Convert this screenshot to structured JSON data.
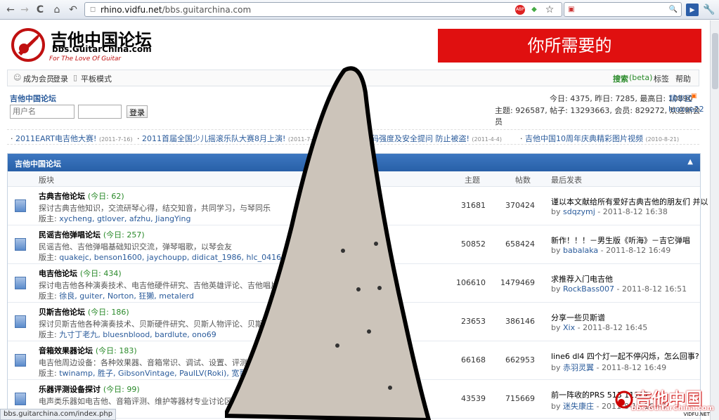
{
  "browser": {
    "url_host": "rhino.vidfu.net",
    "url_path": "/bbs.guitarchina.com",
    "back": "←",
    "forward": "→",
    "reload": "C",
    "home": "⌂",
    "undo": "↶",
    "abp": "ABP",
    "star": "☆",
    "search_icon": "🔍"
  },
  "site": {
    "logo_main": "吉他中国论坛",
    "logo_sub": "bbs.GuitarChina.com",
    "logo_tag": "For The Love Of Guitar",
    "ad_text": "你所需要的"
  },
  "topbar": {
    "register": "成为会员",
    "login": "登录",
    "tablet": "平板模式",
    "search": "搜索",
    "beta": "(beta)",
    "tags": "标签",
    "help": "帮助"
  },
  "userbox": {
    "title": "吉他中国论坛",
    "username_placeholder": "用户名",
    "login_btn": "登录"
  },
  "stats": {
    "line1": "今日: 4375, 昨日: 7285, 最高日: 10890",
    "highlight": "精华区",
    "line2": "主题: 926587, 帖子: 13293663, 会员: 829272, 欢迎新会员",
    "newest": "luoxue22"
  },
  "news": [
    {
      "title": "2011EART电吉他大赛!",
      "date": "(2011-7-16)"
    },
    {
      "title": "2011首届全国少儿摇滚乐队大赛8月上演!",
      "date": "(2011-7-5)"
    },
    {
      "title": "密码强度及安全提问 防止被盗!",
      "date": "(2011-4-4)"
    },
    {
      "title": "吉他中国10周年庆典精彩图片视频",
      "date": "(2010-8-21)"
    }
  ],
  "forum": {
    "title": "吉他中国论坛",
    "collapse": "▲",
    "col_board": "版块",
    "col_topics": "主题",
    "col_posts": "帖数",
    "col_last": "最后发表",
    "boards": [
      {
        "name": "古典吉他论坛",
        "today": "(今日: 62)",
        "desc": "探讨古典吉他知识，交流研琴心得，结交知音，共同学习，与琴同乐",
        "mods_label": "版主:",
        "mods": "xycheng, gtlover, afzhu, JiangYing",
        "topics": "31681",
        "posts": "370424",
        "last": "谨以本文献给所有爱好古典吉他的朋友们 并以 ...",
        "by_label": "by",
        "by": "sdqzymj",
        "time": "- 2011-8-12 16:38"
      },
      {
        "name": "民谣吉他弹唱论坛",
        "today": "(今日: 257)",
        "desc": "民谣吉他、吉他弹唱基础知识交流，弹琴唱歌，以琴会友",
        "mods_label": "版主:",
        "mods": "quakejc, benson1600, jaychoupp, didicat_1986, hlc_0416",
        "topics": "50852",
        "posts": "658424",
        "last": "新作！！！－男生版《听海》－吉它弹唱",
        "by_label": "by",
        "by": "babalaka",
        "time": "- 2011-8-12 16:49"
      },
      {
        "name": "电吉他论坛",
        "today": "(今日: 434)",
        "desc": "探讨电吉他各种演奏技术、电吉他硬件研究、吉他英雄评论、吉他唱片欣赏等",
        "mods_label": "版主:",
        "mods": "徐良, guiter, Norton, 狂獭, metalerd",
        "topics": "106610",
        "posts": "1479469",
        "last": "求推荐入门电吉他",
        "by_label": "by",
        "by": "RockBass007",
        "time": "- 2011-8-12 16:51"
      },
      {
        "name": "贝斯吉他论坛",
        "today": "(今日: 186)",
        "desc": "探讨贝斯吉他各种演奏技术、贝斯硬件研究、贝斯人物评论、贝斯唱片欣赏等",
        "mods_label": "版主:",
        "mods": "九寸丁老九, bluesnblood, bardlute, ono69",
        "topics": "23653",
        "posts": "386146",
        "last": "分享一些贝斯谱",
        "by_label": "by",
        "by": "Xix",
        "time": "- 2011-8-12 16:45"
      },
      {
        "name": "音箱效果器论坛",
        "today": "(今日: 183)",
        "desc": "电吉他周边设备：各种效果器、音箱常识、调试、设置、评测与使用经验",
        "mods_label": "版主:",
        "mods": "twinamp, 胜子, GibsonVintage, PaulLV(Roki), 宽哥",
        "topics": "66168",
        "posts": "662953",
        "last": "line6 dl4 四个灯一起不停闪烁，怎么回事?",
        "by_label": "by",
        "by": "赤羽灵翼",
        "time": "- 2011-8-12 16:49"
      },
      {
        "name": "乐器评测设备探讨",
        "today": "(今日: 99)",
        "desc": "电声类乐器如电吉他、音箱评测、维护等器材专业讨论区，音乐",
        "mods_label": "",
        "mods": "",
        "topics": "43539",
        "posts": "715669",
        "last": "前一阵收的PRS 513 11102",
        "by_label": "by",
        "by": "迷失康庄",
        "time": "- 2011-8-12 16:44"
      }
    ]
  },
  "statusbar": "bbs.guitarchina.com/index.php",
  "watermark": {
    "main": "吉他中国",
    "sub": "bbs.GuitarChina.com",
    "small": "VIDFU.NET"
  }
}
